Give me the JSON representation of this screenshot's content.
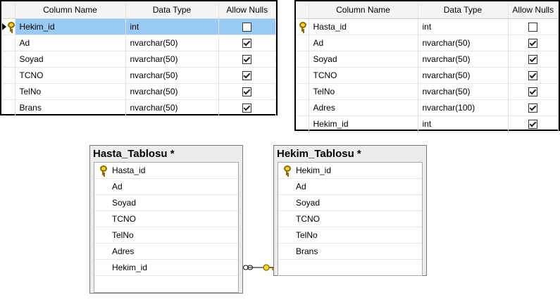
{
  "grid_left": {
    "headers": [
      "Column Name",
      "Data Type",
      "Allow Nulls"
    ],
    "rows": [
      {
        "name": "Hekim_id",
        "type": "int",
        "nulls": false,
        "key": true,
        "selected": true
      },
      {
        "name": "Ad",
        "type": "nvarchar(50)",
        "nulls": true,
        "key": false,
        "selected": false
      },
      {
        "name": "Soyad",
        "type": "nvarchar(50)",
        "nulls": true,
        "key": false,
        "selected": false
      },
      {
        "name": "TCNO",
        "type": "nvarchar(50)",
        "nulls": true,
        "key": false,
        "selected": false
      },
      {
        "name": "TelNo",
        "type": "nvarchar(50)",
        "nulls": true,
        "key": false,
        "selected": false
      },
      {
        "name": "Brans",
        "type": "nvarchar(50)",
        "nulls": true,
        "key": false,
        "selected": false
      }
    ]
  },
  "grid_right": {
    "headers": [
      "Column Name",
      "Data Type",
      "Allow Nulls"
    ],
    "rows": [
      {
        "name": "Hasta_id",
        "type": "int",
        "nulls": false,
        "key": true,
        "selected": false
      },
      {
        "name": "Ad",
        "type": "nvarchar(50)",
        "nulls": true,
        "key": false,
        "selected": false
      },
      {
        "name": "Soyad",
        "type": "nvarchar(50)",
        "nulls": true,
        "key": false,
        "selected": false
      },
      {
        "name": "TCNO",
        "type": "nvarchar(50)",
        "nulls": true,
        "key": false,
        "selected": false
      },
      {
        "name": "TelNo",
        "type": "nvarchar(50)",
        "nulls": true,
        "key": false,
        "selected": false
      },
      {
        "name": "Adres",
        "type": "nvarchar(100)",
        "nulls": true,
        "key": false,
        "selected": false
      },
      {
        "name": "Hekim_id",
        "type": "int",
        "nulls": true,
        "key": false,
        "selected": false
      }
    ]
  },
  "diagram": {
    "hasta": {
      "title": "Hasta_Tablosu *",
      "columns": [
        {
          "name": "Hasta_id",
          "key": true
        },
        {
          "name": "Ad",
          "key": false
        },
        {
          "name": "Soyad",
          "key": false
        },
        {
          "name": "TCNO",
          "key": false
        },
        {
          "name": "TelNo",
          "key": false
        },
        {
          "name": "Adres",
          "key": false
        },
        {
          "name": "Hekim_id",
          "key": false
        }
      ]
    },
    "hekim": {
      "title": "Hekim_Tablosu *",
      "columns": [
        {
          "name": "Hekim_id",
          "key": true
        },
        {
          "name": "Ad",
          "key": false
        },
        {
          "name": "Soyad",
          "key": false
        },
        {
          "name": "TCNO",
          "key": false
        },
        {
          "name": "TelNo",
          "key": false
        },
        {
          "name": "Brans",
          "key": false
        }
      ]
    }
  },
  "icons": {
    "key": "key-icon",
    "row_selector": "row-selector-arrow-icon",
    "relationship": "relationship-connector-icon"
  },
  "colors": {
    "selection": "#99c9f5",
    "key": "#f2d33a"
  }
}
